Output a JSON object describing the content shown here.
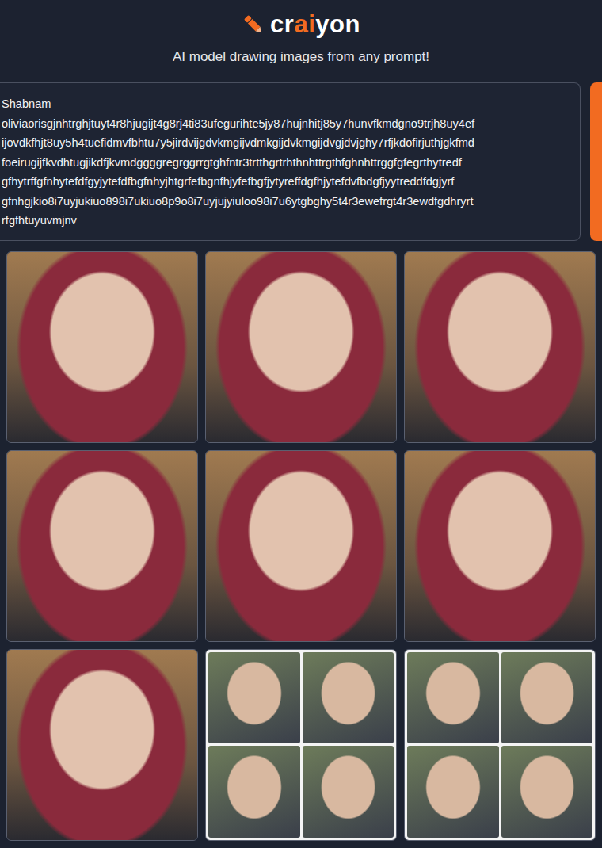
{
  "header": {
    "logo_parts": [
      "cr",
      "ai",
      "yon"
    ],
    "subtitle": "AI model drawing images from any prompt!"
  },
  "prompt": {
    "lines": [
      "Shabnam",
      "oliviaorisgjnhtrghjtuyt4r8hjugijt4g8rj4ti83ufegurihte5jy87hujnhitj85y7hunvfkmdgno9trjh8uy4ef",
      "ijovdkfhjt8uy5h4tuefidmvfbhtu7y5jirdvijgdvkmgijvdmkgijdvkmgijdvgjdvjghy7rfjkdofirjuthjgkfmd",
      "foeirugijfkvdhtugjikdfjkvmdggggregrggrrgtghfntr3trtthgrtrhthnhttrgthfghnhttrggfgfegrthytredf",
      "gfhytrffgfnhytefdfgyjytefdfbgfnhyjhtgrfefbgnfhjyfefbgfjytyreffdgfhjytefdvfbdgfjyytreddfdgjyrf",
      "gfnhgjkio8i7uyjukiuo898i7ukiuo8p9o8i7uyjujyiuloo98i7u6ytgbghy5t4r3ewefrgt4r3ewdfgdhryrt",
      "rfgfhtuyuvmjnv"
    ]
  },
  "results": [
    {
      "kind": "photo"
    },
    {
      "kind": "photo"
    },
    {
      "kind": "photo"
    },
    {
      "kind": "photo"
    },
    {
      "kind": "photo"
    },
    {
      "kind": "photo"
    },
    {
      "kind": "photo"
    },
    {
      "kind": "collage"
    },
    {
      "kind": "collage"
    }
  ]
}
